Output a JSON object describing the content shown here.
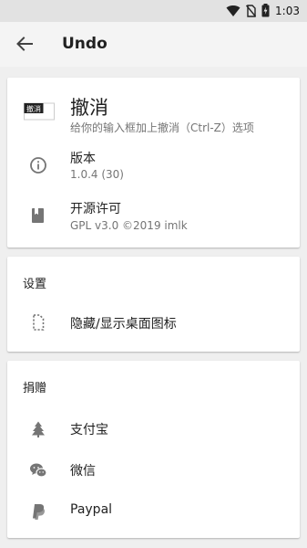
{
  "status_bar": {
    "time": "1:03",
    "icons": [
      "wifi-icon",
      "no-sim-icon",
      "battery-charging-icon"
    ]
  },
  "app_bar": {
    "title": "Undo",
    "back_icon": "arrow-back-icon"
  },
  "about": {
    "app_name": "撤消",
    "app_description": "给你的输入框加上撤消（Ctrl-Z）选项",
    "logo_text": "撤消",
    "version_label": "版本",
    "version_value": "1.0.4 (30)",
    "license_label": "开源许可",
    "license_value": "GPL v3.0 ©2019 imlk"
  },
  "settings": {
    "header": "设置",
    "items": [
      {
        "label": "隐藏/显示桌面图标",
        "icon": "dashed-file-icon"
      }
    ]
  },
  "donate": {
    "header": "捐赠",
    "items": [
      {
        "label": "支付宝",
        "icon": "tree-icon"
      },
      {
        "label": "微信",
        "icon": "wechat-icon"
      },
      {
        "label": "Paypal",
        "icon": "paypal-icon"
      }
    ]
  },
  "colors": {
    "background": "#efefef",
    "card": "#ffffff",
    "icon_gray": "#757575",
    "primary_text": "#212121",
    "secondary_text": "#757575"
  }
}
